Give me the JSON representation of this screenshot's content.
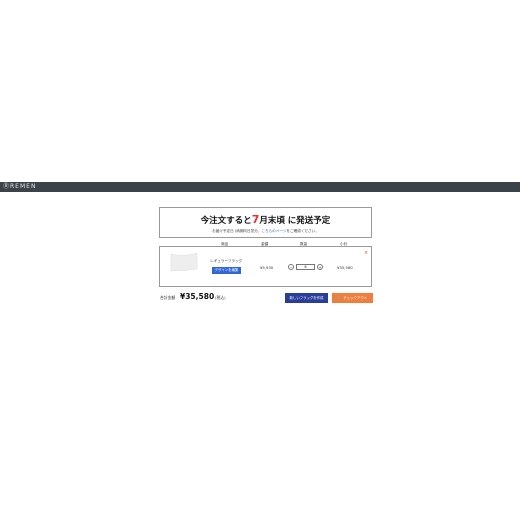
{
  "header": {
    "brand": "REMEN"
  },
  "shipping": {
    "title_prefix": "今注文すると",
    "title_month": "7",
    "title_suffix": "月末頃 に発送予定",
    "sub_prefix": "お届け予定日 (納期向日您分、",
    "sub_link": "こちらのページ",
    "sub_suffix": "をご確認ください。"
  },
  "columns": {
    "product": "商品",
    "price": "金額",
    "quantity": "数量",
    "subtotal": "小計"
  },
  "cart": {
    "items": [
      {
        "name": "レギュラーフラッグ",
        "design_button": "デザインを編集",
        "price": "¥5,930",
        "quantity": "6",
        "subtotal": "¥35,580",
        "remove": "×",
        "minus": "−",
        "plus": "+"
      }
    ]
  },
  "summary": {
    "total_label": "合計金額",
    "total_value": "¥35,580",
    "tax_note": "(税込)"
  },
  "actions": {
    "new_flag": "新しいフラッグを作成",
    "checkout": "チェックアウト"
  },
  "colors": {
    "header_bg": "#3c4249",
    "accent_red": "#e53333",
    "design_button": "#3167d4",
    "new_flag_button": "#2b3d9a",
    "checkout_button": "#ee7f3d"
  },
  "icons": {
    "checkout": "cart-icon",
    "remove": "close-icon"
  }
}
